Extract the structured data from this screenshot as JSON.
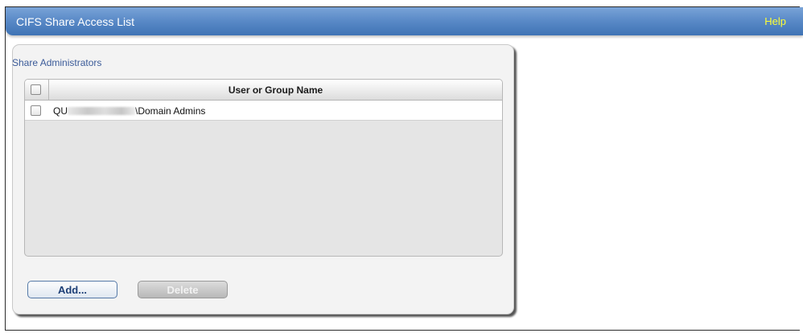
{
  "header": {
    "title": "CIFS Share Access List",
    "help_label": "Help"
  },
  "section": {
    "title": "Share Administrators"
  },
  "table": {
    "column_header": "User or Group Name",
    "rows": [
      {
        "prefix": "QU",
        "suffix": "\\Domain Admins",
        "checked": false
      }
    ]
  },
  "buttons": {
    "add_label": "Add...",
    "delete_label": "Delete"
  },
  "colors": {
    "titlebar": "#4a7fc0",
    "help_link": "#ffff33",
    "section_title": "#3b5b99"
  }
}
